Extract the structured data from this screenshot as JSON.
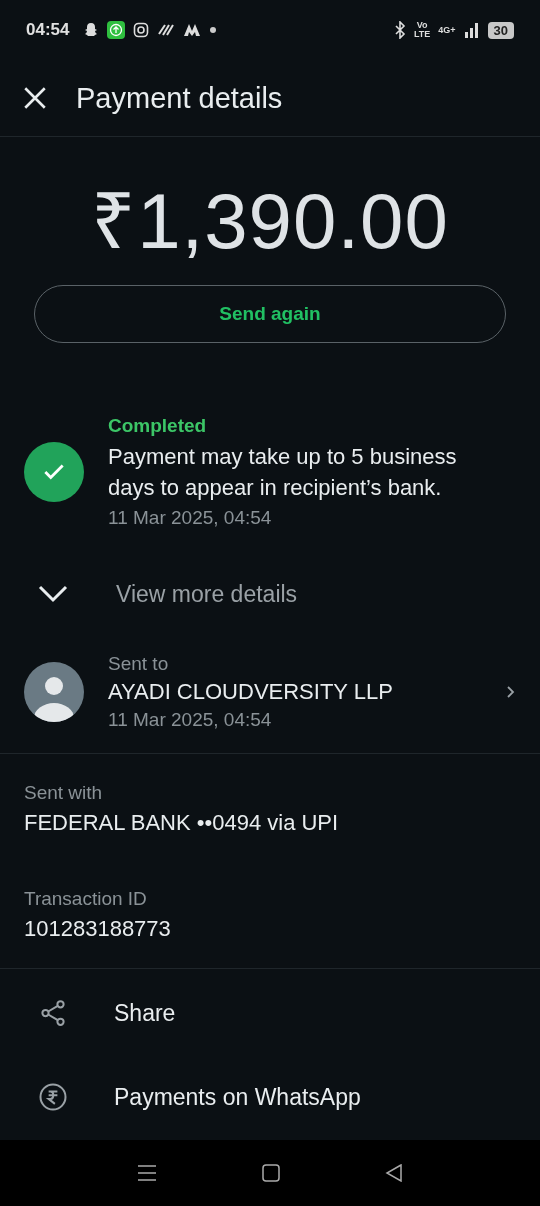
{
  "status_bar": {
    "time": "04:54",
    "network_volte": "Vo\nLTE",
    "network_type": "4G+",
    "battery": "30"
  },
  "header": {
    "title": "Payment details"
  },
  "amount": "₹1,390.00",
  "send_again": "Send again",
  "status": {
    "kind": "completed",
    "label": "Completed",
    "message": "Payment may take up to 5 business days to appear in recipient’s bank.",
    "time": "11 Mar 2025, 04:54"
  },
  "view_more": {
    "label": "View more details",
    "expanded": false
  },
  "recipient": {
    "label": "Sent to",
    "name": "AYADI CLOUDVERSITY LLP",
    "time": "11 Mar 2025, 04:54"
  },
  "details": [
    {
      "label": "Sent with",
      "value": "FEDERAL BANK ••0494 via UPI"
    },
    {
      "label": "Transaction ID",
      "value": "101283188773"
    }
  ],
  "actions": [
    {
      "kind": "share",
      "label": "Share"
    },
    {
      "kind": "rupee",
      "label": "Payments on WhatsApp"
    }
  ]
}
